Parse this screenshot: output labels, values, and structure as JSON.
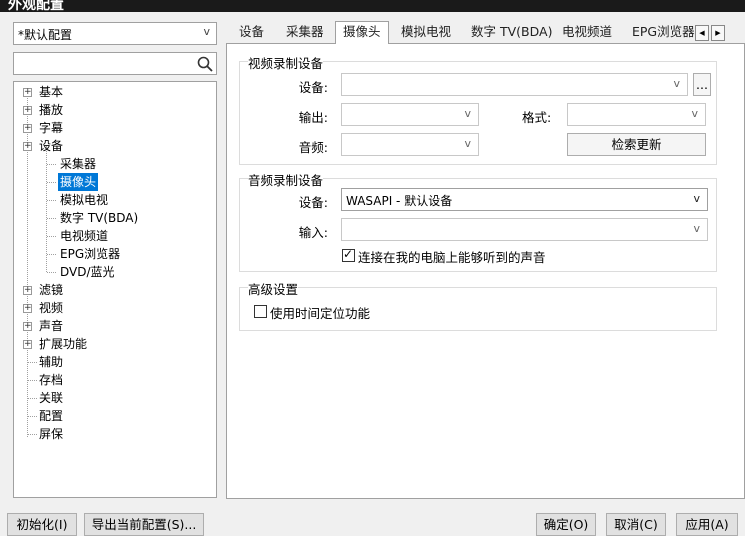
{
  "window": {
    "title": "外观配置"
  },
  "left": {
    "preset": "*默认配置",
    "search_placeholder": "",
    "tree": [
      {
        "label": "基本",
        "expandable": true
      },
      {
        "label": "播放",
        "expandable": true
      },
      {
        "label": "字幕",
        "expandable": true
      },
      {
        "label": "设备",
        "expandable": true,
        "expanded": true
      },
      {
        "label": "采集器",
        "child": true
      },
      {
        "label": "摄像头",
        "child": true,
        "selected": true
      },
      {
        "label": "模拟电视",
        "child": true
      },
      {
        "label": "数字 TV(BDA)",
        "child": true
      },
      {
        "label": "电视频道",
        "child": true
      },
      {
        "label": "EPG浏览器",
        "child": true
      },
      {
        "label": "DVD/蓝光",
        "child": true
      },
      {
        "label": "滤镜",
        "expandable": true
      },
      {
        "label": "视频",
        "expandable": true
      },
      {
        "label": "声音",
        "expandable": true
      },
      {
        "label": "扩展功能",
        "expandable": true
      },
      {
        "label": "辅助"
      },
      {
        "label": "存档"
      },
      {
        "label": "关联"
      },
      {
        "label": "配置"
      },
      {
        "label": "屏保"
      }
    ]
  },
  "tabs": [
    "设备",
    "采集器",
    "摄像头",
    "模拟电视",
    "数字 TV(BDA)",
    "电视频道",
    "EPG浏览器"
  ],
  "active_tab": "摄像头",
  "video_group": {
    "title": "视频录制设备",
    "device_label": "设备:",
    "device_value": "",
    "browse_label": "...",
    "output_label": "输出:",
    "output_value": "",
    "format_label": "格式:",
    "format_value": "",
    "audio_label": "音频:",
    "audio_value": "",
    "refresh_label": "检索更新"
  },
  "audio_group": {
    "title": "音频录制设备",
    "device_label": "设备:",
    "device_value": "WASAPI - 默认设备",
    "input_label": "输入:",
    "input_value": "",
    "loopback_label": "连接在我的电脑上能够听到的声音",
    "loopback_checked": true
  },
  "advanced_group": {
    "title": "高级设置",
    "timeshift_label": "使用时间定位功能",
    "timeshift_checked": false
  },
  "buttons": {
    "init": "初始化(I)",
    "export": "导出当前配置(S)...",
    "ok": "确定(O)",
    "cancel": "取消(C)",
    "apply": "应用(A)"
  },
  "chevron": "v",
  "expander_plus": "+"
}
